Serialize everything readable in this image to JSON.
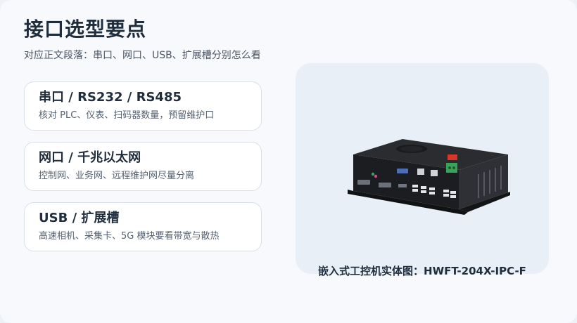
{
  "title": "接口选型要点",
  "subtitle": "对应正文段落：串口、网口、USB、扩展槽分别怎么看",
  "cards": [
    {
      "title": "串口 / RS232 / RS485",
      "desc": "核对 PLC、仪表、扫码器数量，预留维护口"
    },
    {
      "title": "网口 / 千兆以太网",
      "desc": "控制网、业务网、远程维护网尽量分离"
    },
    {
      "title": "USB / 扩展槽",
      "desc": "高速相机、采集卡、5G 模块要看带宽与散热"
    }
  ],
  "caption": "嵌入式工控机实体图：HWFT-204X-IPC-F",
  "colors": {
    "background": "#f7f9fc",
    "panel": "#e9eff6",
    "card_border": "#d9e0ea",
    "title": "#1f2d3d",
    "terminal_green": "#3aa35a",
    "red_badge": "#d8352b"
  }
}
